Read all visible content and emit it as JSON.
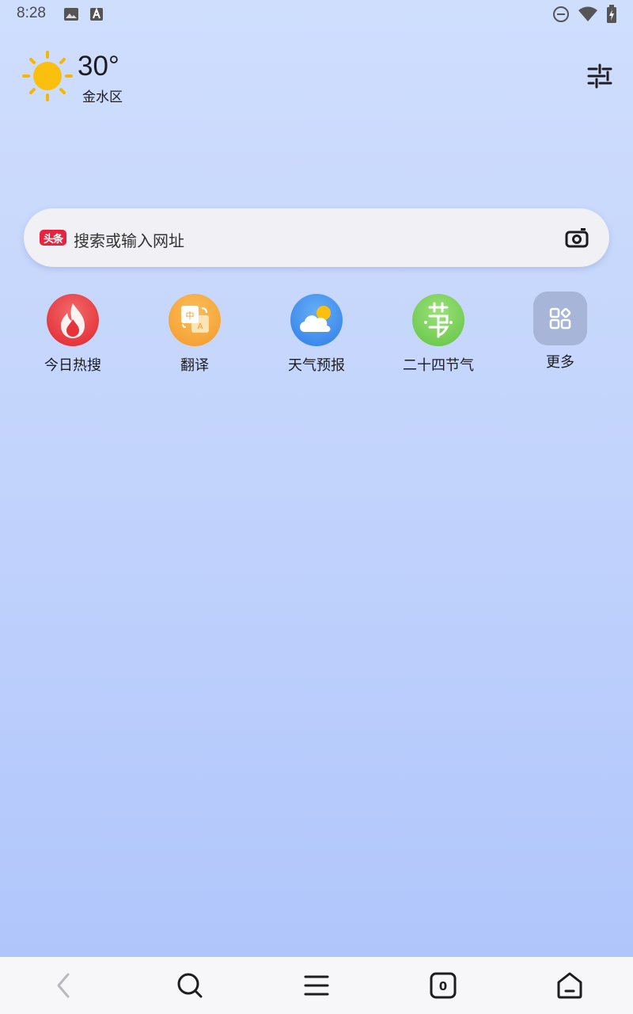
{
  "status_bar": {
    "time": "8:28",
    "icons": [
      "image-icon",
      "font-icon",
      "do-not-disturb-icon",
      "wifi-icon",
      "battery-icon"
    ]
  },
  "weather": {
    "temperature": "30°",
    "district": "金水区",
    "icon": "sun-icon"
  },
  "header": {
    "settings_icon": "sliders-icon"
  },
  "search": {
    "badge": "头条",
    "placeholder": "搜索或输入网址",
    "camera_icon": "camera-icon"
  },
  "shortcuts": [
    {
      "label": "今日热搜",
      "icon": "fire-icon",
      "color": "#e8323b"
    },
    {
      "label": "翻译",
      "icon": "translate-icon",
      "color": "#f7a23b"
    },
    {
      "label": "天气预报",
      "icon": "weather-cloud-icon",
      "color": "#3f8ff2"
    },
    {
      "label": "二十四节气",
      "icon": "solar-term-icon",
      "color": "#7dd557"
    },
    {
      "label": "更多",
      "icon": "apps-grid-icon",
      "color": "#a6b3d6"
    }
  ],
  "translate_icon_chars": {
    "zh": "中",
    "en": "A"
  },
  "bottom_nav": {
    "tab_count": "0",
    "items": [
      "back-icon",
      "search-icon",
      "menu-icon",
      "tabs-icon",
      "home-icon"
    ]
  }
}
